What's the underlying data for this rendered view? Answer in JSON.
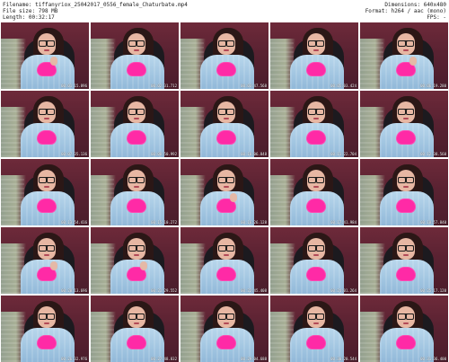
{
  "header": {
    "filename": "Filename: tiffanyriox_25042017_0556_female_Chaturbate.mp4",
    "filesize": "File size: 798 MB",
    "length": "Length: 00:32:17",
    "dimensions": "Dimensions: 640x480",
    "format": "Format: h264 / aac (mono)",
    "fps": "FPS: -"
  },
  "thumbs": [
    {
      "timestamp": "00:01:15.896"
    },
    {
      "timestamp": "00:02:31.712"
    },
    {
      "timestamp": "00:03:47.568"
    },
    {
      "timestamp": "00:05:03.424"
    },
    {
      "timestamp": "00:06:19.280"
    },
    {
      "timestamp": "00:07:35.136"
    },
    {
      "timestamp": "00:08:50.992"
    },
    {
      "timestamp": "00:10:06.848"
    },
    {
      "timestamp": "00:11:22.704"
    },
    {
      "timestamp": "00:12:38.560"
    },
    {
      "timestamp": "00:13:54.416"
    },
    {
      "timestamp": "00:15:10.272"
    },
    {
      "timestamp": "00:16:26.128"
    },
    {
      "timestamp": "00:17:41.984"
    },
    {
      "timestamp": "00:18:57.840"
    },
    {
      "timestamp": "00:20:13.696"
    },
    {
      "timestamp": "00:21:29.552"
    },
    {
      "timestamp": "00:22:45.408"
    },
    {
      "timestamp": "00:24:01.264"
    },
    {
      "timestamp": "00:25:17.120"
    },
    {
      "timestamp": "00:26:32.976"
    },
    {
      "timestamp": "00:27:48.832"
    },
    {
      "timestamp": "00:29:04.688"
    },
    {
      "timestamp": "00:30:20.544"
    },
    {
      "timestamp": "00:31:36.400"
    }
  ]
}
